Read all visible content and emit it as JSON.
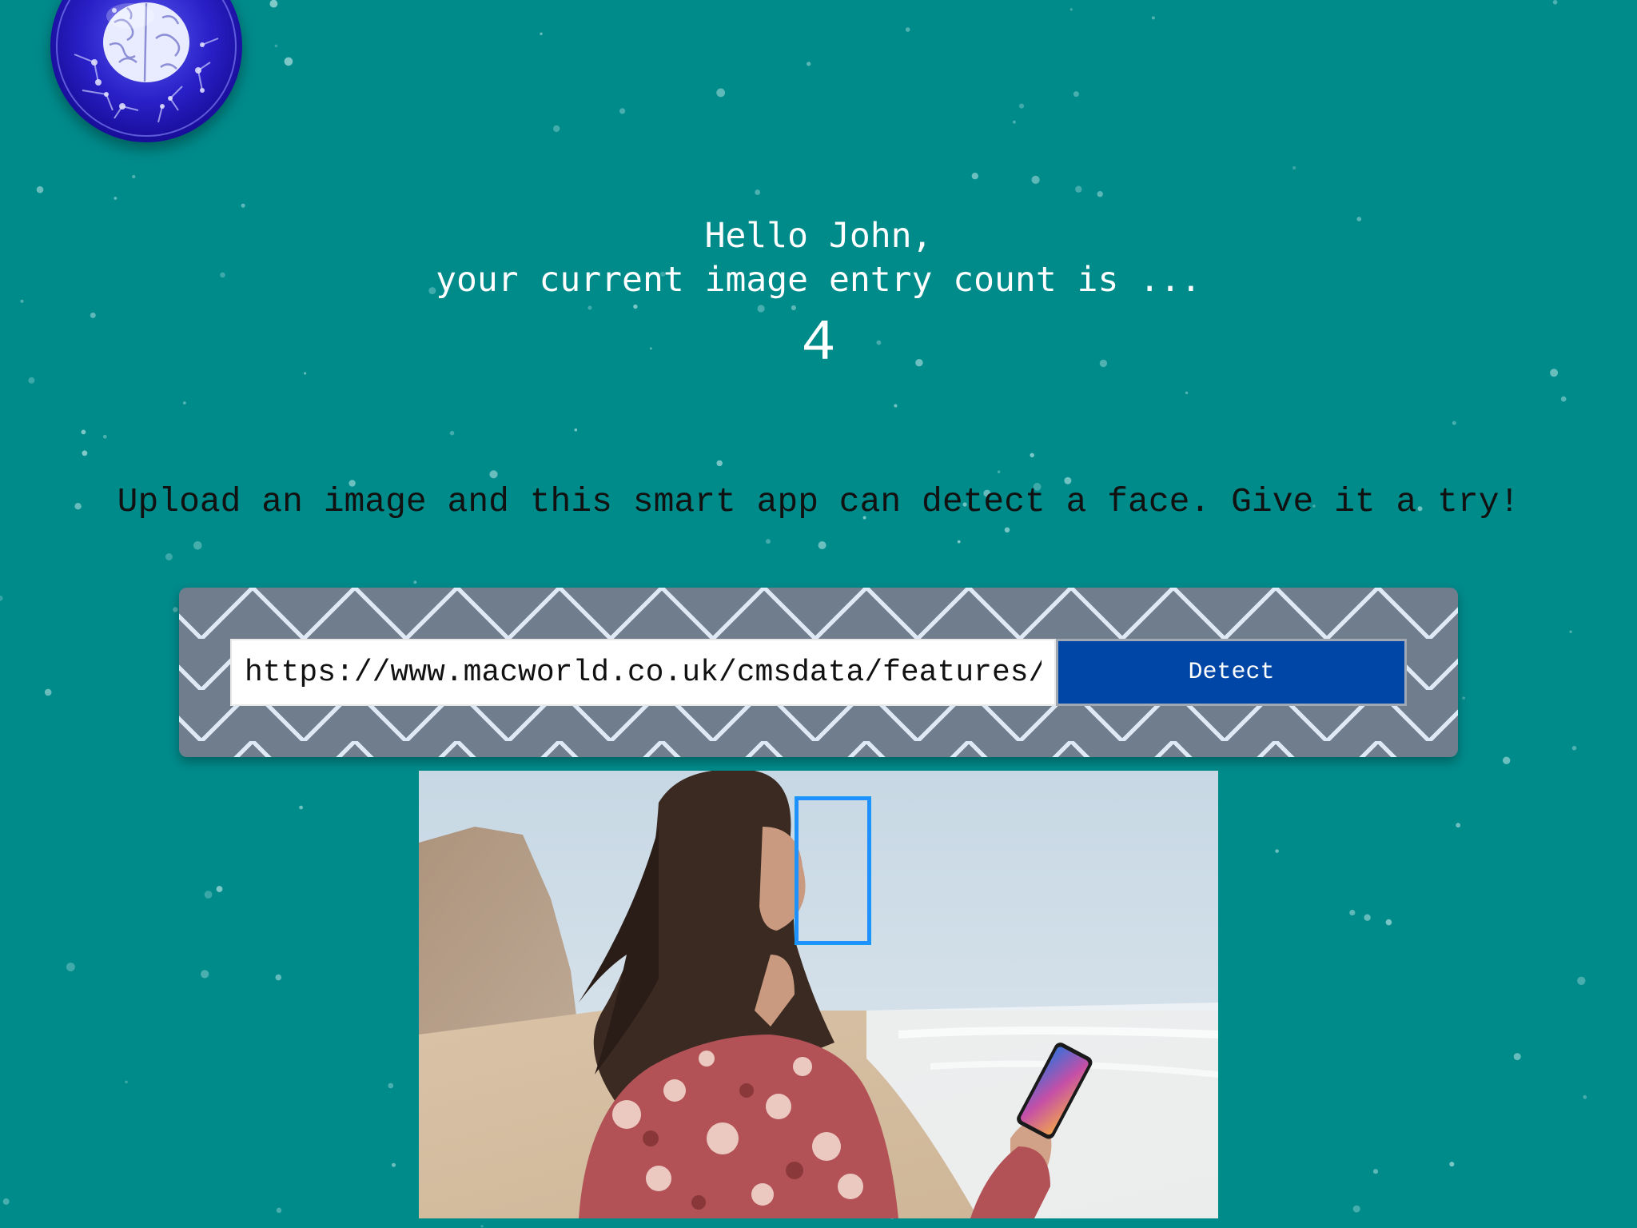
{
  "app": {
    "logo": "brain-circuit-logo",
    "greeting_line1": "Hello John,",
    "greeting_line2": "your current image entry count is ...",
    "entry_count": "4",
    "tagline": "Upload an image and this smart app can detect a face. Give it a try!"
  },
  "form": {
    "url_value": "https://www.macworld.co.uk/cmsdata/features/",
    "detect_label": "Detect"
  },
  "result": {
    "image_icon": "photo-woman-with-phone",
    "face_box_icon": "face-bounding-box"
  },
  "colors": {
    "background": "#008b8b",
    "button": "#0046a6",
    "face_box": "#1e90ff",
    "panel": "#6f7d8c"
  }
}
